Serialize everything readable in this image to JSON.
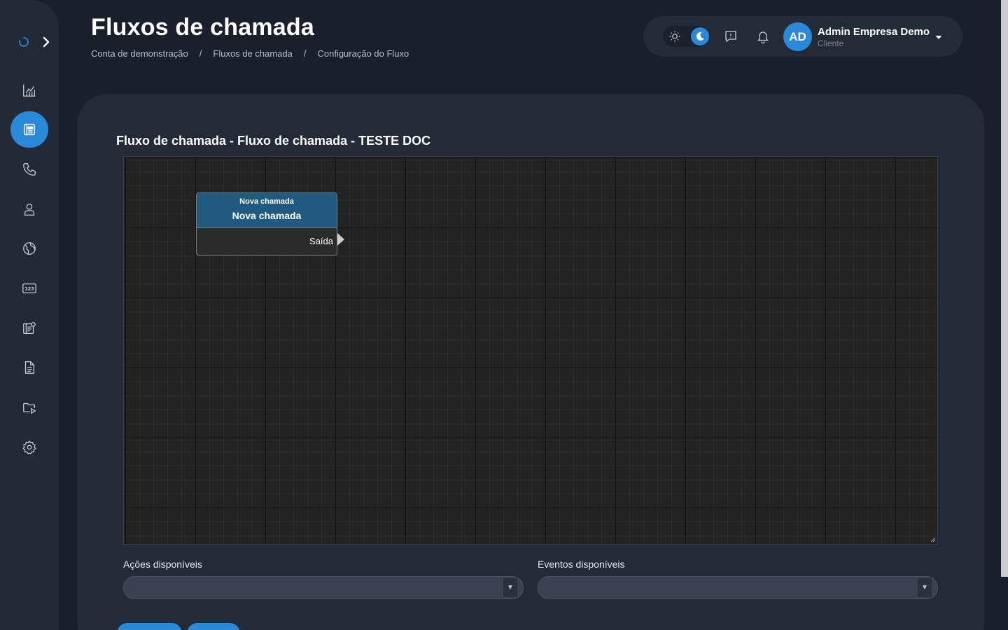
{
  "header": {
    "title": "Fluxos de chamada",
    "breadcrumb": [
      "Conta de demonstração",
      "Fluxos de chamada",
      "Configuração do Fluxo"
    ],
    "breadcrumb_separator": "/"
  },
  "user": {
    "initials": "AD",
    "name": "Admin Empresa Demo",
    "role": "Cliente"
  },
  "sidebar": {
    "items": [
      {
        "icon": "chart-icon"
      },
      {
        "icon": "phonebook-icon",
        "active": true
      },
      {
        "icon": "phone-icon"
      },
      {
        "icon": "user-icon"
      },
      {
        "icon": "globe-icon"
      },
      {
        "icon": "numpad-123-icon"
      },
      {
        "icon": "contact-list-icon"
      },
      {
        "icon": "document-icon"
      },
      {
        "icon": "media-folder-icon"
      },
      {
        "icon": "gear-icon"
      }
    ]
  },
  "main": {
    "flow_title": "Fluxo de chamada - Fluxo de chamada - TESTE DOC",
    "node": {
      "type": "Nova chamada",
      "name": "Nova chamada",
      "output": "Saída"
    },
    "actions_label": "Ações disponíveis",
    "actions_value": "",
    "events_label": "Eventos disponíveis",
    "events_value": "",
    "select_arrow": "▼"
  },
  "colors": {
    "accent": "#2a88d8",
    "node_header": "#215a80",
    "background": "#1a202b",
    "card": "#232a38"
  }
}
